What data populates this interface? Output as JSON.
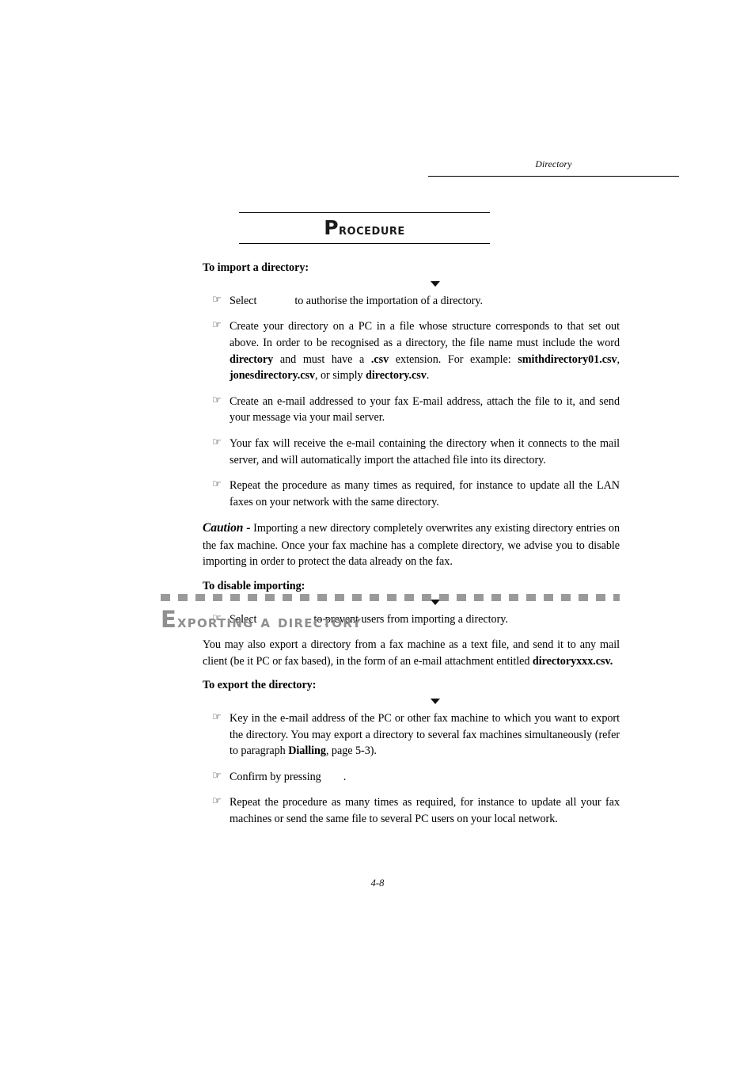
{
  "page": {
    "running_header": "Directory",
    "footer_page_number": "4-8"
  },
  "procedure_banner": {
    "title_initial": "P",
    "title_rest": "rocedure"
  },
  "import_section": {
    "lead": "To import a directory:",
    "bullets": [
      {
        "prefix": "Select",
        "suffix": "to authorise the importation of a directory."
      },
      {
        "text_1": "Create your directory on a PC in a file whose structure corresponds to that set out above. In order to be recognised as a directory, the file name must include the word ",
        "bold_1": "directory",
        "text_2": " and must have a ",
        "bold_2": ".csv",
        "text_3": " extension. For example: ",
        "bold_3": "smithdirectory01.csv",
        "text_4": ", ",
        "bold_4": "jonesdirectory.csv",
        "text_5": ", or simply ",
        "bold_5": "directory.csv",
        "text_6": "."
      },
      {
        "text": "Create an e-mail addressed to your fax E-mail address, attach the file to it, and send your message via your mail server."
      },
      {
        "text": "Your fax will receive the e-mail containing the directory when it connects to the mail server, and will automatically import the attached file into its directory."
      },
      {
        "text": "Repeat the procedure as many times as required, for instance to update all the LAN faxes on your network with the same directory."
      }
    ]
  },
  "caution": {
    "label": "Caution -",
    "text": " Importing a new directory completely overwrites any existing directory entries on the fax machine. Once your fax machine has a complete directory, we advise you to disable importing in order to protect the data already on the fax."
  },
  "disable_section": {
    "lead": "To disable importing:",
    "bullet": {
      "prefix": "Select",
      "suffix": "to prevent users from importing a directory."
    }
  },
  "export_section": {
    "heading_initial": "E",
    "heading_rest": "xporting a directory",
    "intro_text_1": "You may also export a directory from a fax machine as a text file, and send it to any mail client (be it PC or fax based), in the form of an e-mail attachment entitled ",
    "intro_bold": "directoryxxx.csv.",
    "lead": "To export the directory:",
    "bullets": [
      {
        "text_1": "Key in the e-mail address of the PC or other fax machine to which you want to export the directory. You may export a directory to several fax machines simultaneously (refer to paragraph ",
        "bold_1": "Dialling",
        "text_2": ", page 5-3)."
      },
      {
        "prefix": "Confirm by pressing",
        "suffix": "."
      },
      {
        "text": "Repeat the procedure as many times as required, for instance to update all your fax machines or send the same file to several PC users on your local network."
      }
    ]
  },
  "icons": {
    "hand_bullet": "☞",
    "down_triangle": "down-triangle-marker"
  },
  "colors": {
    "text": "#000000",
    "section_heading_gray": "#8f8f8f",
    "dash_bar_gray": "#9a9a9a"
  }
}
